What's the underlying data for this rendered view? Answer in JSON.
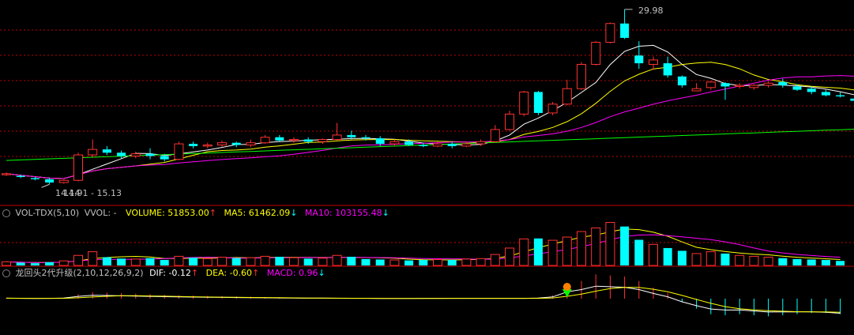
{
  "colors": {
    "up": "#ff3232",
    "down": "#00ffff",
    "ma5": "#ffffff",
    "ma10": "#ffff00",
    "ma20": "#ff00ff",
    "ma60": "#00ff00",
    "grid": "#c00000",
    "text": "#c0c0c0",
    "dif": "#ffffff",
    "dea": "#ffff00",
    "macd": "#ff00ff",
    "signal": "#00ff00"
  },
  "price_panel": {
    "high_marker": "29.98",
    "low_marker": "14.14",
    "range_label": "14.91 - 15.13"
  },
  "volume_panel": {
    "indicator": "VOL-TDX(5,10)",
    "vol_label": "VVOL: -",
    "volume_label": "VOLUME: 51853.00",
    "volume_arrow": "↑",
    "ma5_label": "MA5: 61462.09",
    "ma5_arrow": "↓",
    "ma10_label": "MA10: 103155.48",
    "ma10_arrow": "↓"
  },
  "macd_panel": {
    "indicator": "龙回头2代升级(2,10,12,26,9,2)",
    "dif_label": "DIF: -0.12",
    "dif_arrow": "↑",
    "dea_label": "DEA: -0.60",
    "dea_arrow": "↑",
    "macd_label": "MACD: 0.96",
    "macd_arrow": "↓"
  },
  "chart_data": {
    "type": "candlestick",
    "candles": [
      {
        "o": 15.0,
        "c": 15.1,
        "h": 15.2,
        "l": 14.9
      },
      {
        "o": 14.9,
        "c": 14.8,
        "h": 15.0,
        "l": 14.7
      },
      {
        "o": 14.7,
        "c": 14.6,
        "h": 14.8,
        "l": 14.5
      },
      {
        "o": 14.6,
        "c": 14.3,
        "h": 14.7,
        "l": 14.14
      },
      {
        "o": 14.3,
        "c": 14.5,
        "h": 14.6,
        "l": 14.2
      },
      {
        "o": 14.5,
        "c": 16.8,
        "h": 17.0,
        "l": 14.4
      },
      {
        "o": 16.8,
        "c": 17.3,
        "h": 18.2,
        "l": 16.6
      },
      {
        "o": 17.3,
        "c": 17.0,
        "h": 17.6,
        "l": 16.8
      },
      {
        "o": 17.0,
        "c": 16.7,
        "h": 17.2,
        "l": 16.5
      },
      {
        "o": 16.7,
        "c": 16.9,
        "h": 17.1,
        "l": 16.5
      },
      {
        "o": 16.9,
        "c": 16.7,
        "h": 17.4,
        "l": 16.4
      },
      {
        "o": 16.7,
        "c": 16.4,
        "h": 16.9,
        "l": 16.2
      },
      {
        "o": 16.4,
        "c": 17.8,
        "h": 18.0,
        "l": 16.3
      },
      {
        "o": 17.8,
        "c": 17.6,
        "h": 18.0,
        "l": 17.4
      },
      {
        "o": 17.6,
        "c": 17.7,
        "h": 17.9,
        "l": 17.4
      },
      {
        "o": 17.7,
        "c": 17.9,
        "h": 18.1,
        "l": 17.5
      },
      {
        "o": 17.9,
        "c": 17.7,
        "h": 18.0,
        "l": 17.5
      },
      {
        "o": 17.7,
        "c": 17.9,
        "h": 18.2,
        "l": 17.5
      },
      {
        "o": 17.9,
        "c": 18.4,
        "h": 18.6,
        "l": 17.8
      },
      {
        "o": 18.4,
        "c": 18.1,
        "h": 18.6,
        "l": 18.0
      },
      {
        "o": 18.1,
        "c": 18.2,
        "h": 18.4,
        "l": 17.9
      },
      {
        "o": 18.2,
        "c": 18.0,
        "h": 18.4,
        "l": 17.8
      },
      {
        "o": 18.0,
        "c": 18.2,
        "h": 18.3,
        "l": 17.8
      },
      {
        "o": 18.2,
        "c": 18.6,
        "h": 19.7,
        "l": 18.1
      },
      {
        "o": 18.6,
        "c": 18.4,
        "h": 19.0,
        "l": 18.2
      },
      {
        "o": 18.4,
        "c": 18.3,
        "h": 18.6,
        "l": 18.1
      },
      {
        "o": 18.3,
        "c": 17.8,
        "h": 18.5,
        "l": 17.6
      },
      {
        "o": 17.8,
        "c": 18.0,
        "h": 18.2,
        "l": 17.6
      },
      {
        "o": 18.0,
        "c": 17.7,
        "h": 18.2,
        "l": 17.6
      },
      {
        "o": 17.7,
        "c": 17.6,
        "h": 17.9,
        "l": 17.5
      },
      {
        "o": 17.6,
        "c": 17.8,
        "h": 18.0,
        "l": 17.5
      },
      {
        "o": 17.8,
        "c": 17.6,
        "h": 18.0,
        "l": 17.4
      },
      {
        "o": 17.6,
        "c": 17.8,
        "h": 18.0,
        "l": 17.5
      },
      {
        "o": 17.8,
        "c": 18.0,
        "h": 18.2,
        "l": 17.6
      },
      {
        "o": 18.0,
        "c": 19.1,
        "h": 19.5,
        "l": 17.9
      },
      {
        "o": 19.1,
        "c": 20.5,
        "h": 20.8,
        "l": 19.0
      },
      {
        "o": 20.5,
        "c": 22.5,
        "h": 22.6,
        "l": 20.3
      },
      {
        "o": 22.5,
        "c": 20.6,
        "h": 22.6,
        "l": 20.4
      },
      {
        "o": 20.6,
        "c": 21.4,
        "h": 21.6,
        "l": 20.4
      },
      {
        "o": 21.4,
        "c": 22.8,
        "h": 23.6,
        "l": 21.3
      },
      {
        "o": 22.8,
        "c": 25.0,
        "h": 25.2,
        "l": 22.7
      },
      {
        "o": 25.0,
        "c": 27.0,
        "h": 27.1,
        "l": 24.9
      },
      {
        "o": 27.0,
        "c": 28.7,
        "h": 28.8,
        "l": 26.9
      },
      {
        "o": 28.7,
        "c": 27.4,
        "h": 29.98,
        "l": 27.3
      },
      {
        "o": 25.8,
        "c": 25.1,
        "h": 27.1,
        "l": 24.6
      },
      {
        "o": 25.0,
        "c": 25.4,
        "h": 25.7,
        "l": 24.5
      },
      {
        "o": 25.1,
        "c": 24.0,
        "h": 25.7,
        "l": 23.8
      },
      {
        "o": 23.9,
        "c": 23.1,
        "h": 24.0,
        "l": 22.9
      },
      {
        "o": 22.6,
        "c": 22.8,
        "h": 23.3,
        "l": 22.6
      },
      {
        "o": 22.9,
        "c": 23.4,
        "h": 23.5,
        "l": 22.7
      },
      {
        "o": 23.3,
        "c": 23.0,
        "h": 23.4,
        "l": 21.8
      },
      {
        "o": 23.0,
        "c": 23.1,
        "h": 23.3,
        "l": 22.8
      },
      {
        "o": 22.9,
        "c": 23.1,
        "h": 23.2,
        "l": 22.7
      },
      {
        "o": 23.1,
        "c": 23.3,
        "h": 23.5,
        "l": 22.9
      },
      {
        "o": 23.4,
        "c": 23.1,
        "h": 23.7,
        "l": 22.9
      },
      {
        "o": 23.0,
        "c": 22.7,
        "h": 23.2,
        "l": 22.6
      },
      {
        "o": 22.8,
        "c": 22.5,
        "h": 23.0,
        "l": 22.3
      },
      {
        "o": 22.5,
        "c": 22.2,
        "h": 22.7,
        "l": 22.1
      },
      {
        "o": 22.2,
        "c": 22.1,
        "h": 22.5,
        "l": 22.0
      },
      {
        "o": 21.9,
        "c": 21.7,
        "h": 22.1,
        "l": 21.6
      }
    ],
    "volume": [
      8,
      6,
      5,
      7,
      10,
      22,
      30,
      18,
      15,
      14,
      16,
      12,
      20,
      17,
      15,
      18,
      16,
      17,
      20,
      19,
      17,
      15,
      16,
      22,
      19,
      14,
      13,
      12,
      11,
      12,
      13,
      12,
      14,
      15,
      24,
      38,
      58,
      59,
      55,
      62,
      74,
      82,
      94,
      85,
      56,
      46,
      38,
      32,
      26,
      30,
      26,
      22,
      20,
      18,
      16,
      14,
      13,
      12,
      10
    ],
    "macd": [
      0.08,
      0.06,
      0.04,
      0.05,
      0.1,
      0.4,
      0.6,
      0.55,
      0.5,
      0.45,
      0.4,
      0.35,
      0.3,
      0.28,
      0.25,
      0.22,
      0.2,
      0.18,
      0.15,
      0.12,
      0.1,
      0.09,
      0.08,
      0.07,
      0.06,
      0.05,
      0.04,
      0.04,
      0.04,
      0.05,
      0.05,
      0.06,
      0.06,
      0.06,
      0.05,
      0.05,
      0.05,
      0.1,
      0.3,
      1.2,
      1.6,
      2.2,
      2.1,
      2.0,
      1.6,
      1.0,
      0.5,
      -0.3,
      -0.9,
      -1.4,
      -1.5,
      -1.4,
      -1.5,
      -1.6,
      -1.5,
      -1.4,
      -1.3,
      -1.3,
      -1.4
    ]
  }
}
